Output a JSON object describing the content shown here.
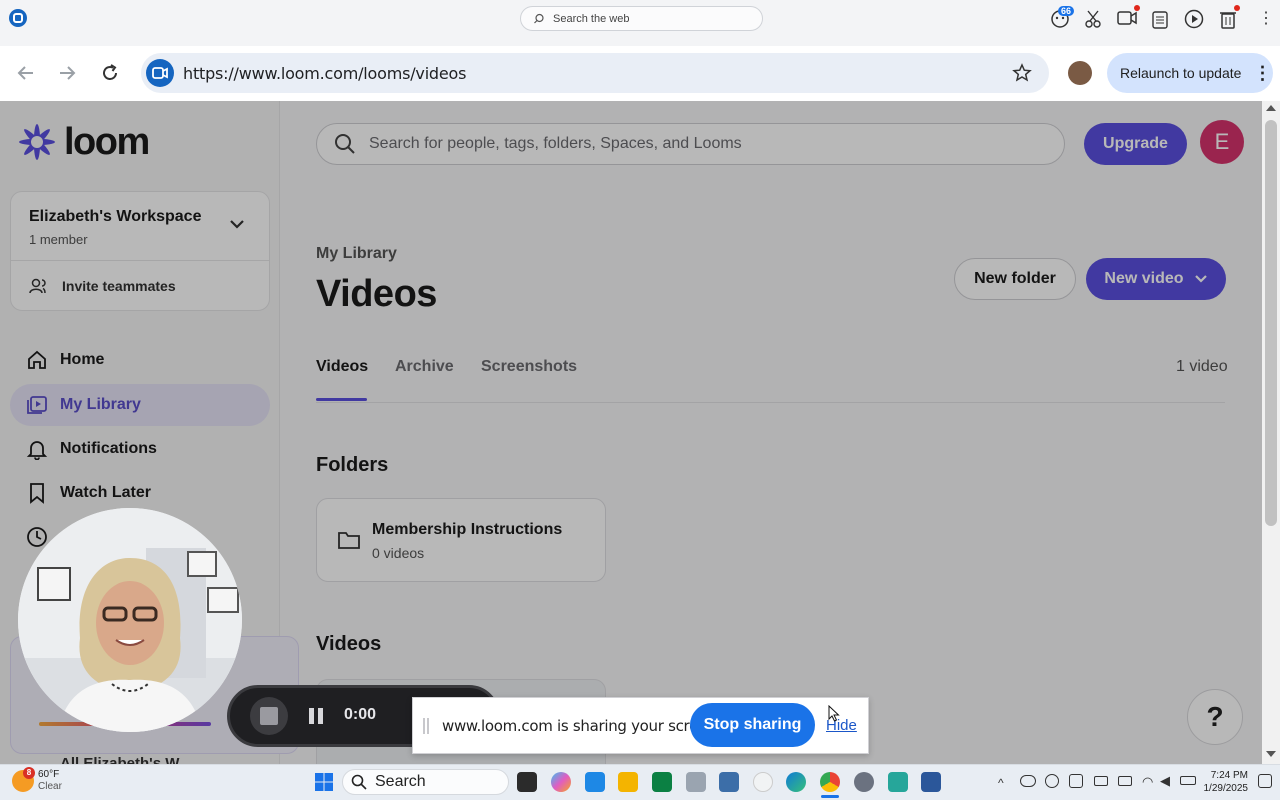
{
  "browser": {
    "search_web_placeholder": "Search the web",
    "badge_count": "66",
    "url": "https://www.loom.com/looms/videos",
    "relaunch_label": "Relaunch to update"
  },
  "app": {
    "logo_text": "loom",
    "search_placeholder": "Search for people, tags, folders, Spaces, and Looms",
    "upgrade_label": "Upgrade",
    "avatar_initial": "E",
    "accent_color": "#5b4fdf"
  },
  "sidebar": {
    "workspace_name": "Elizabeth's Workspace",
    "workspace_members": "1 member",
    "invite_label": "Invite teammates",
    "items": [
      {
        "label": "Home",
        "icon": "home-icon"
      },
      {
        "label": "My Library",
        "icon": "library-icon",
        "active": true
      },
      {
        "label": "Notifications",
        "icon": "bell-icon"
      },
      {
        "label": "Watch Later",
        "icon": "bookmark-icon"
      }
    ],
    "bottom_label": "All Elizabeth's W..."
  },
  "main": {
    "breadcrumb": "My Library",
    "title": "Videos",
    "new_folder_label": "New folder",
    "new_video_label": "New video",
    "tabs": [
      {
        "label": "Videos",
        "active": true
      },
      {
        "label": "Archive"
      },
      {
        "label": "Screenshots"
      }
    ],
    "video_count": "1 video",
    "folders_heading": "Folders",
    "folders": [
      {
        "name": "Membership Instructions",
        "count": "0 videos"
      }
    ],
    "videos_heading": "Videos",
    "help_label": "?"
  },
  "recording": {
    "timer": "0:00",
    "share_message": "www.loom.com is sharing your screen.",
    "stop_sharing_label": "Stop sharing",
    "hide_label": "Hide"
  },
  "taskbar": {
    "weather_temp": "60°F",
    "weather_desc": "Clear",
    "weather_badge": "8",
    "search_label": "Search",
    "time": "7:24 PM",
    "date": "1/29/2025"
  }
}
